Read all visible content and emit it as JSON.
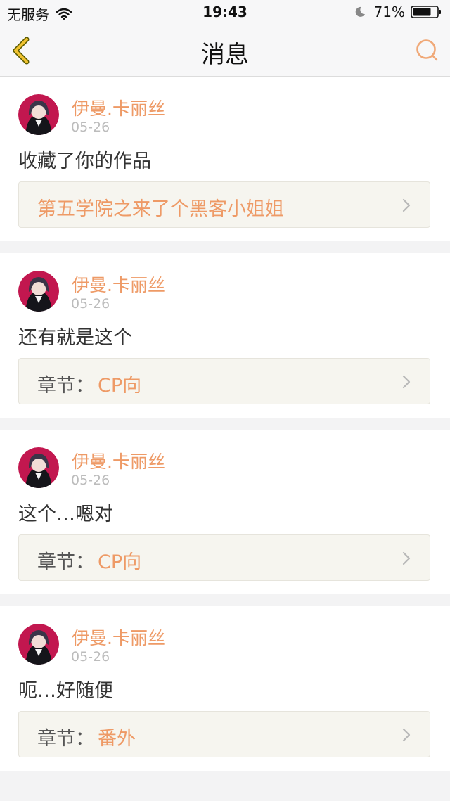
{
  "status_bar": {
    "carrier": "无服务",
    "time": "19:43",
    "battery": "71%"
  },
  "nav": {
    "title": "消息",
    "back_icon": "chevron-left-icon",
    "search_icon": "search-icon",
    "accent_color": "#f0c230"
  },
  "messages": [
    {
      "user": "伊曼.卡丽丝",
      "date": "05-26",
      "text": "收藏了你的作品",
      "link_prefix": "",
      "link_title": "第五学院之来了个黑客小姐姐"
    },
    {
      "user": "伊曼.卡丽丝",
      "date": "05-26",
      "text": "还有就是这个",
      "link_prefix": "章节：",
      "link_title": "CP向"
    },
    {
      "user": "伊曼.卡丽丝",
      "date": "05-26",
      "text": "这个…嗯对",
      "link_prefix": "章节：",
      "link_title": "CP向"
    },
    {
      "user": "伊曼.卡丽丝",
      "date": "05-26",
      "text": "呃…好随便",
      "link_prefix": "章节：",
      "link_title": "番外"
    }
  ],
  "colors": {
    "username": "#ee9a66",
    "link_title": "#ee9a66",
    "date": "#bcbcbc"
  }
}
